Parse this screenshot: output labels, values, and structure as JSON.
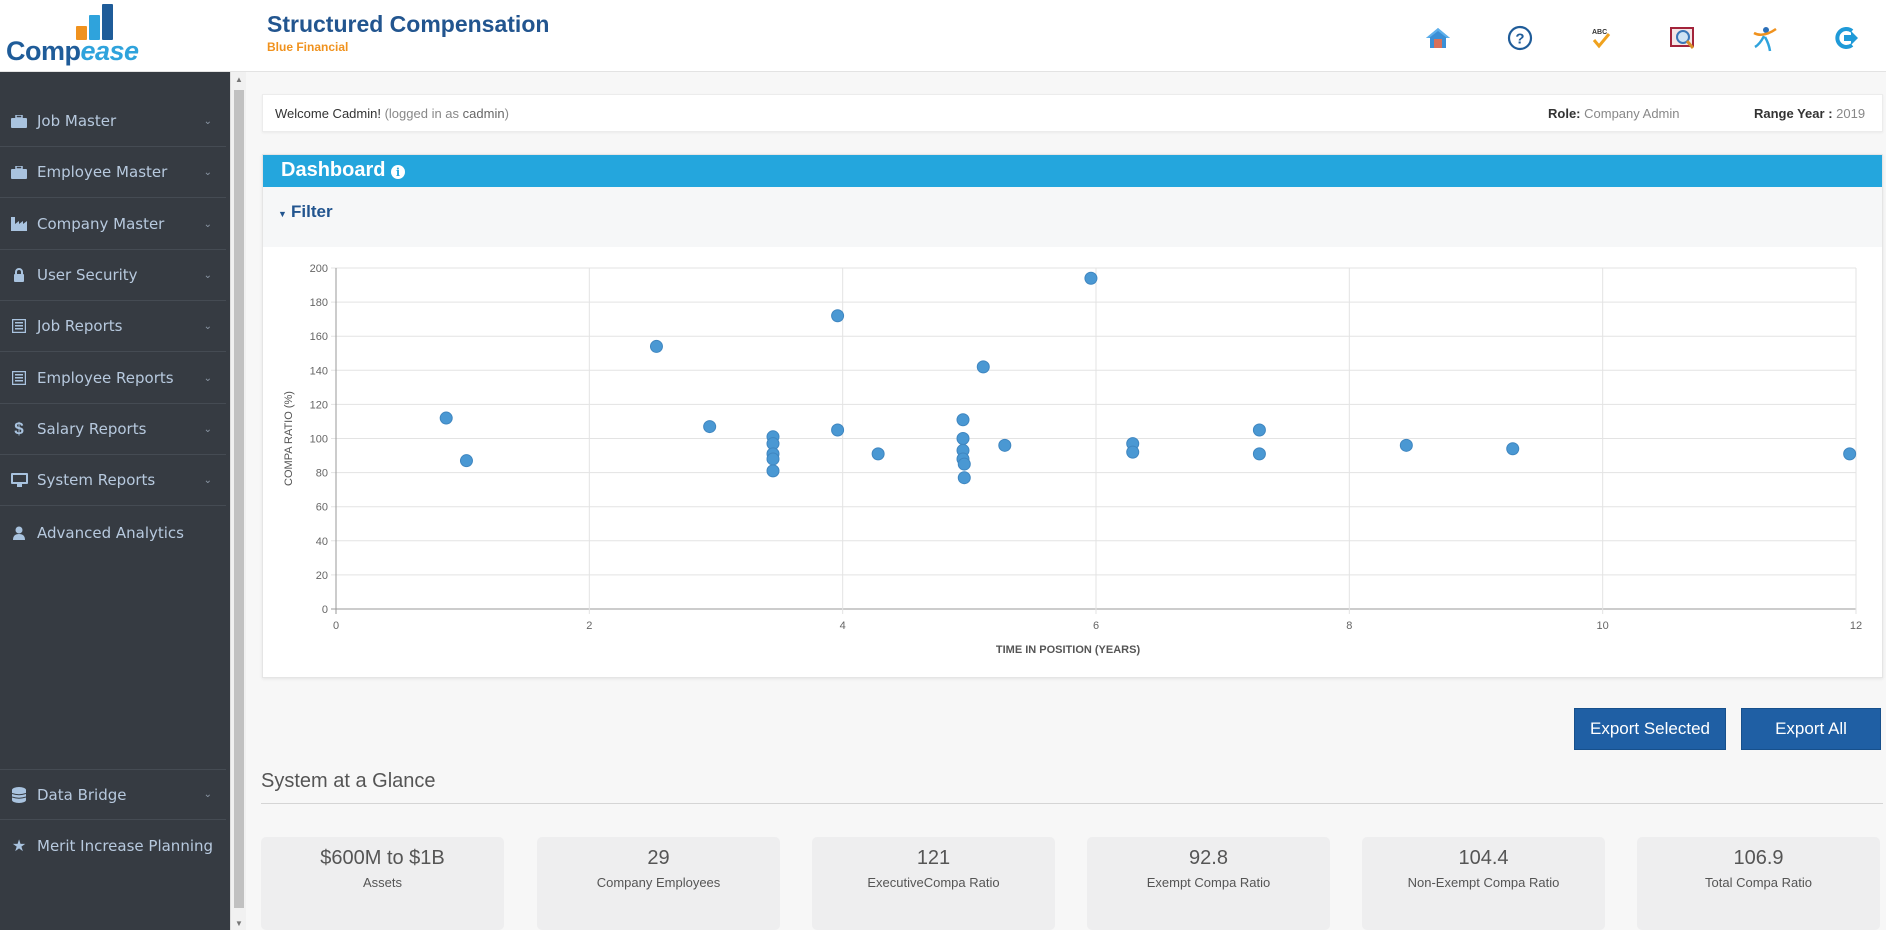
{
  "app": {
    "logo_text_main": "Comp",
    "logo_text_accent": "ease",
    "title": "Structured Compensation",
    "subtitle": "Blue Financial"
  },
  "top_icons": [
    {
      "name": "home-icon",
      "label": "Home"
    },
    {
      "name": "help-icon",
      "label": "Help"
    },
    {
      "name": "spellcheck-icon",
      "label": "ABC"
    },
    {
      "name": "search-book-icon",
      "label": "Search"
    },
    {
      "name": "user-figure-icon",
      "label": "User"
    },
    {
      "name": "logout-icon",
      "label": "Logout"
    }
  ],
  "sidebar": {
    "items": [
      {
        "label": "Job Master",
        "icon": "briefcase-icon",
        "expandable": true
      },
      {
        "label": "Employee Master",
        "icon": "briefcase-icon",
        "expandable": true
      },
      {
        "label": "Company Master",
        "icon": "factory-icon",
        "expandable": true
      },
      {
        "label": "User Security",
        "icon": "lock-icon",
        "expandable": true
      },
      {
        "label": "Job Reports",
        "icon": "report-icon",
        "expandable": true
      },
      {
        "label": "Employee Reports",
        "icon": "report-icon",
        "expandable": true
      },
      {
        "label": "Salary Reports",
        "icon": "dollar-icon",
        "expandable": true
      },
      {
        "label": "System Reports",
        "icon": "monitor-icon",
        "expandable": true
      },
      {
        "label": "Advanced Analytics",
        "icon": "user-icon",
        "expandable": false
      }
    ],
    "bottom_items": [
      {
        "label": "Data Bridge",
        "icon": "database-icon",
        "expandable": true
      },
      {
        "label": "Merit Increase Planning",
        "icon": "star-icon",
        "expandable": false
      }
    ]
  },
  "welcome": {
    "greeting": "Welcome Cadmin!",
    "logged_prefix": "(logged in as ",
    "username": "cadmin",
    "logged_suffix": ")",
    "role_label": "Role:",
    "role_value": "Company Admin",
    "range_year_label": "Range Year :",
    "range_year_value": "2019"
  },
  "dashboard": {
    "title": "Dashboard",
    "info_icon": "i",
    "filter_label": "Filter"
  },
  "chart_data": {
    "type": "scatter",
    "title": "",
    "xlabel": "TIME IN POSITION (YEARS)",
    "ylabel": "COMPA RATIO (%)",
    "xlim": [
      0,
      12
    ],
    "ylim": [
      0,
      200
    ],
    "xticks": [
      0,
      2,
      4,
      6,
      8,
      10,
      12
    ],
    "yticks": [
      0,
      20,
      40,
      60,
      80,
      100,
      120,
      140,
      160,
      180,
      200
    ],
    "grid": true,
    "legend": "none",
    "color": "#4a98d3",
    "points": [
      {
        "x": 0.87,
        "y": 112
      },
      {
        "x": 1.03,
        "y": 87
      },
      {
        "x": 2.53,
        "y": 154
      },
      {
        "x": 2.95,
        "y": 107
      },
      {
        "x": 3.45,
        "y": 101
      },
      {
        "x": 3.45,
        "y": 97
      },
      {
        "x": 3.45,
        "y": 91
      },
      {
        "x": 3.45,
        "y": 88
      },
      {
        "x": 3.45,
        "y": 81
      },
      {
        "x": 3.96,
        "y": 172
      },
      {
        "x": 3.96,
        "y": 105
      },
      {
        "x": 4.28,
        "y": 91
      },
      {
        "x": 4.95,
        "y": 111
      },
      {
        "x": 4.95,
        "y": 100
      },
      {
        "x": 4.95,
        "y": 93
      },
      {
        "x": 4.95,
        "y": 88
      },
      {
        "x": 4.96,
        "y": 85
      },
      {
        "x": 4.96,
        "y": 77
      },
      {
        "x": 5.11,
        "y": 142
      },
      {
        "x": 5.28,
        "y": 96
      },
      {
        "x": 5.96,
        "y": 194
      },
      {
        "x": 6.29,
        "y": 97
      },
      {
        "x": 6.29,
        "y": 92
      },
      {
        "x": 7.29,
        "y": 105
      },
      {
        "x": 7.29,
        "y": 91
      },
      {
        "x": 8.45,
        "y": 96
      },
      {
        "x": 9.29,
        "y": 94
      },
      {
        "x": 11.95,
        "y": 91
      }
    ]
  },
  "actions": {
    "export_selected": "Export Selected",
    "export_all": "Export All"
  },
  "glance": {
    "title": "System at a Glance",
    "cards": [
      {
        "value": "$600M to $1B",
        "label": "Assets"
      },
      {
        "value": "29",
        "label": "Company Employees"
      },
      {
        "value": "121",
        "label": "ExecutiveCompa Ratio"
      },
      {
        "value": "92.8",
        "label": "Exempt Compa Ratio"
      },
      {
        "value": "104.4",
        "label": "Non-Exempt Compa Ratio"
      },
      {
        "value": "106.9",
        "label": "Total Compa Ratio"
      }
    ]
  }
}
